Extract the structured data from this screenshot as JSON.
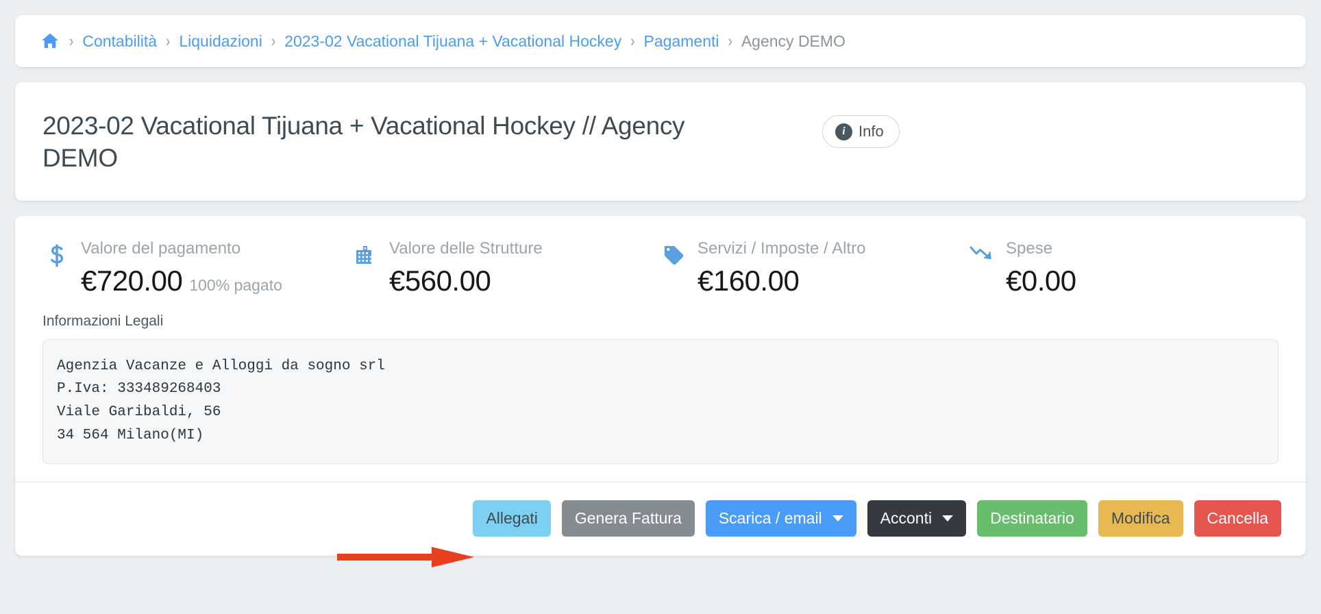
{
  "breadcrumb": {
    "home_icon": "home-icon",
    "separator": "›",
    "items": [
      {
        "label": "Contabilità",
        "current": false
      },
      {
        "label": "Liquidazioni",
        "current": false
      },
      {
        "label": "2023-02 Vacational Tijuana + Vacational Hockey",
        "current": false
      },
      {
        "label": "Pagamenti",
        "current": false
      },
      {
        "label": "Agency DEMO",
        "current": true
      }
    ]
  },
  "header": {
    "title": "2023-02 Vacational Tijuana + Vacational Hockey // Agency DEMO",
    "info_button": "Info",
    "info_icon": "info-circle-icon"
  },
  "stats": [
    {
      "icon": "dollar-sign-icon",
      "label": "Valore del pagamento",
      "value": "€720.00",
      "sub": "100% pagato"
    },
    {
      "icon": "building-icon",
      "label": "Valore delle Strutture",
      "value": "€560.00",
      "sub": ""
    },
    {
      "icon": "tag-icon",
      "label": "Servizi / Imposte / Altro",
      "value": "€160.00",
      "sub": ""
    },
    {
      "icon": "chart-line-down-icon",
      "label": "Spese",
      "value": "€0.00",
      "sub": ""
    }
  ],
  "legal": {
    "label": "Informazioni Legali",
    "text": "Agenzia Vacanze e Alloggi da sogno srl\nP.Iva: 333489268403\nViale Garibaldi, 56\n34 564 Milano(MI)"
  },
  "actions": [
    {
      "label": "Allegati",
      "style": "btn-info",
      "caret": false,
      "name": "attachments-button"
    },
    {
      "label": "Genera Fattura",
      "style": "btn-sec",
      "caret": false,
      "name": "generate-invoice-button"
    },
    {
      "label": "Scarica / email",
      "style": "btn-primary",
      "caret": true,
      "name": "download-email-dropdown"
    },
    {
      "label": "Acconti",
      "style": "btn-dark",
      "caret": true,
      "name": "deposits-dropdown"
    },
    {
      "label": "Destinatario",
      "style": "btn-success",
      "caret": false,
      "name": "recipient-button"
    },
    {
      "label": "Modifica",
      "style": "btn-warning",
      "caret": false,
      "name": "edit-button"
    },
    {
      "label": "Cancella",
      "style": "btn-danger",
      "caret": false,
      "name": "delete-button"
    }
  ],
  "annotation": {
    "arrow_color": "#e8401f",
    "points_to": "Allegati"
  },
  "colors": {
    "page_background": "#eceff1",
    "card_background": "#ffffff",
    "link": "#4a9cf6",
    "muted": "#9aa5ac",
    "icon_accent": "#5a9fde",
    "title": "#3e4b54"
  }
}
